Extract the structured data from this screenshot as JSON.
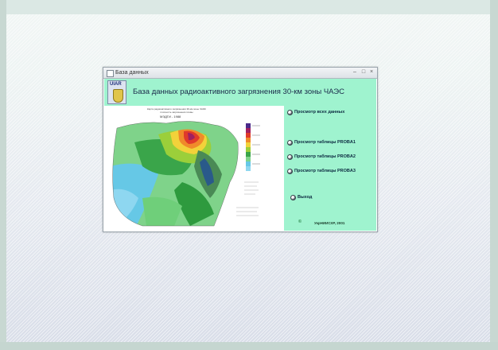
{
  "window": {
    "title": "База данных",
    "min_glyph": "–",
    "max_glyph": "□",
    "close_glyph": "×"
  },
  "header": {
    "logo_text": "UIAR",
    "title": "База данных радиоактивного загрязнения 30-км зоны ЧАЭС"
  },
  "map": {
    "caption_line1": "Карта радиоактивного загрязнения 30-км зоны ЧАЭС",
    "caption_line2": "плотность загрязнения почвы",
    "caption_sub": "МЭДГИ - 1988"
  },
  "menu": {
    "items": [
      {
        "label": "Просмотр всех данных"
      },
      {
        "label": "Просмотр таблицы PROBA1"
      },
      {
        "label": "Просмотр таблицы PROBA2"
      },
      {
        "label": "Просмотр таблицы PROBA3"
      },
      {
        "label": "Выход"
      }
    ],
    "copyright_symbol": "©",
    "copyright_text": "УкрНИИСХР, 2001"
  },
  "colors": {
    "panel_bg": "#9ff3cf",
    "title_text": "#1a2a4a"
  }
}
